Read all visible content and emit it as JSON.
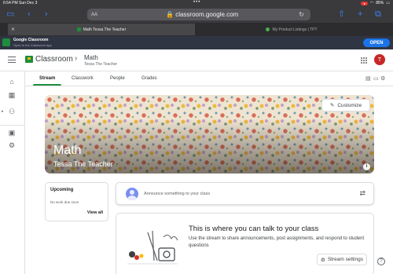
{
  "status_bar": {
    "time": "6:54 PM",
    "date": "Sun Dec 3",
    "battery": "85%"
  },
  "safari": {
    "text_size": "AA",
    "url": "classroom.google.com",
    "tabs": [
      {
        "label": "Math Tessa The Teacher",
        "active": true
      },
      {
        "label": "My Product Listings | TPT",
        "active": false
      }
    ]
  },
  "app_banner": {
    "name": "Google Classroom",
    "subtitle": "Open in the Classroom app",
    "button": "OPEN"
  },
  "header": {
    "app_title": "Classroom",
    "class_name": "Math",
    "class_teacher": "Tessa The Teacher",
    "avatar_letter": "T"
  },
  "tabs": [
    "Stream",
    "Classwork",
    "People",
    "Grades"
  ],
  "banner": {
    "title": "Math",
    "subtitle": "Tessa The Teacher",
    "customize_label": "Customize"
  },
  "upcoming": {
    "heading": "Upcoming",
    "empty_text": "No work due soon",
    "view_all": "View all"
  },
  "announce": {
    "placeholder": "Announce something to your class"
  },
  "stream_info": {
    "title": "This is where you can talk to your class",
    "description": "Use the stream to share announcements, post assignments, and respond to student questions",
    "settings_label": "Stream settings"
  },
  "colors": {
    "accent_green": "#1e8e3e",
    "open_button_blue": "#1a73e8",
    "avatar_red": "#c62828"
  }
}
